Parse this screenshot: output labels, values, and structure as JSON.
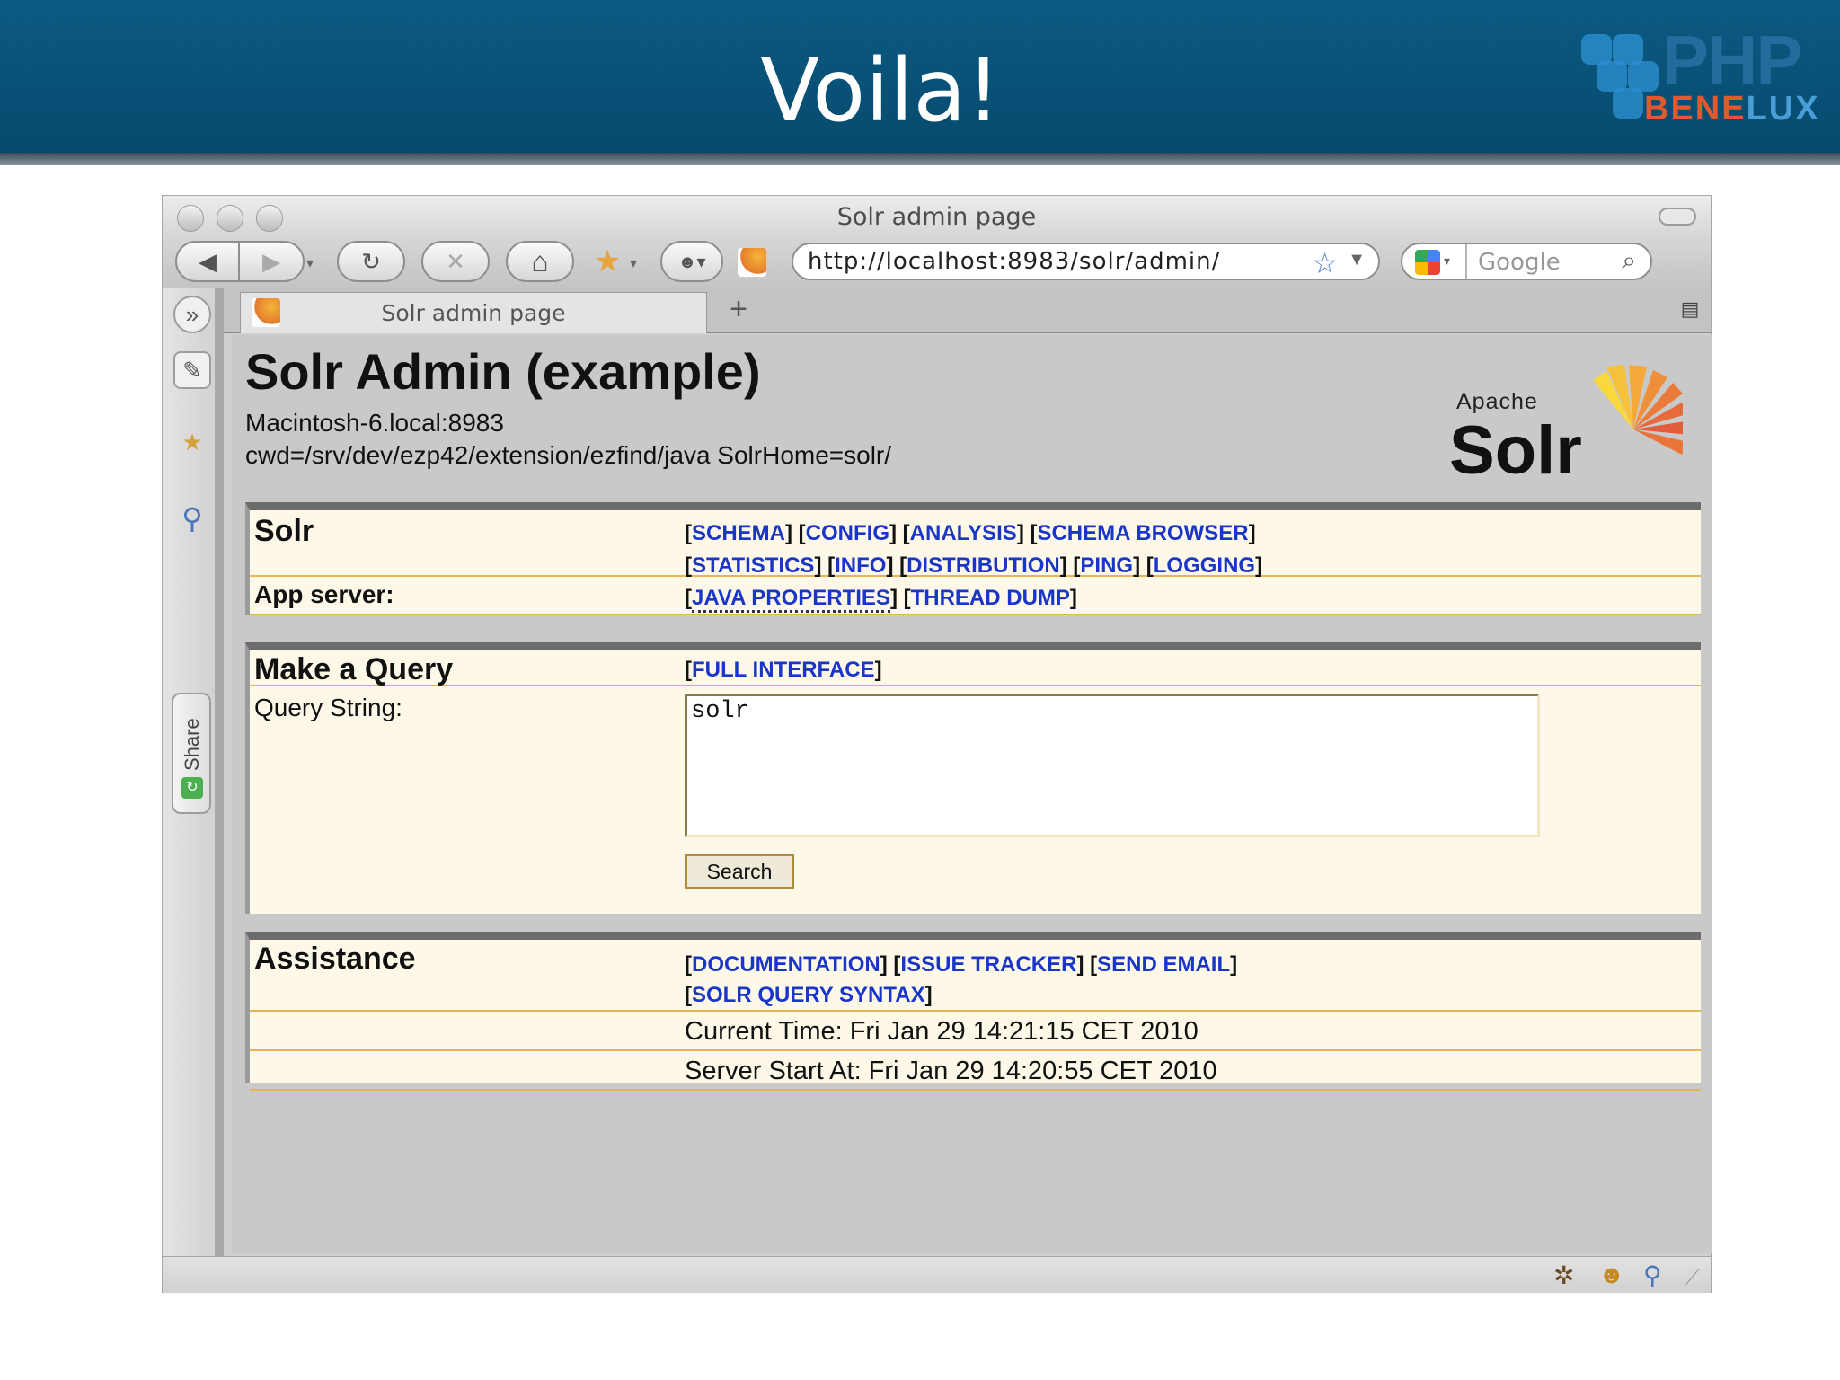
{
  "slide": {
    "title": "Voila!",
    "logo_php": "PHP",
    "logo_bene": "BENE",
    "logo_lux": "LUX"
  },
  "browser": {
    "window_title": "Solr admin page",
    "url": "http://localhost:8983/solr/admin/",
    "search_placeholder": "Google",
    "tab_title": "Solr admin page",
    "tab_add": "+",
    "favicon_label": "Solr",
    "share_label": "Share"
  },
  "page": {
    "heading": "Solr Admin (example)",
    "host": "Macintosh-6.local:8983",
    "cwd": "cwd=/srv/dev/ezp42/extension/ezfind/java SolrHome=solr/",
    "logo_apache": "Apache",
    "logo_solr": "Solr"
  },
  "solr_panel": {
    "label": "Solr",
    "links_row1": [
      "SCHEMA",
      "CONFIG",
      "ANALYSIS",
      "SCHEMA BROWSER"
    ],
    "links_row2": [
      "STATISTICS",
      "INFO",
      "DISTRIBUTION",
      "PING",
      "LOGGING"
    ],
    "app_server_label": "App server:",
    "app_links": [
      "JAVA PROPERTIES",
      "THREAD DUMP"
    ]
  },
  "query_panel": {
    "label": "Make a Query",
    "full_interface": "FULL INTERFACE",
    "query_label": "Query String:",
    "query_value": "solr",
    "search_button": "Search"
  },
  "assist_panel": {
    "label": "Assistance",
    "links_row1": [
      "DOCUMENTATION",
      "ISSUE TRACKER",
      "SEND EMAIL"
    ],
    "links_row2": [
      "SOLR QUERY SYNTAX"
    ],
    "current_time": "Current Time: Fri Jan 29 14:21:15 CET 2010",
    "server_start": "Server Start At: Fri Jan 29 14:20:55 CET 2010"
  },
  "icons": {
    "back": "◀",
    "forward": "▶",
    "reload": "↻",
    "stop": "✕",
    "home": "⌂",
    "bookmark_star": "☆",
    "search": "⌕",
    "expand": "»",
    "tools": "✎"
  },
  "colors": {
    "header_bg": "#0c5a82",
    "link": "#1a36c8",
    "panel_bg": "#fdf8e8",
    "row_border": "#e8b553"
  }
}
